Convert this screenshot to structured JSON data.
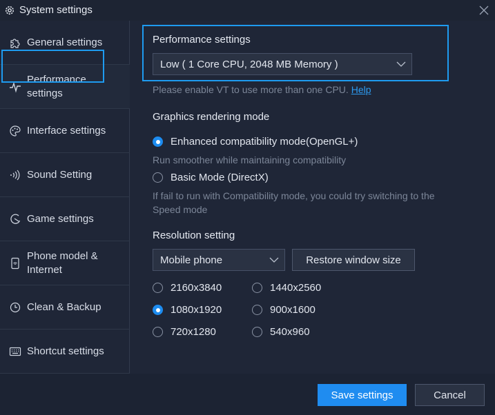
{
  "window": {
    "title": "System settings"
  },
  "sidebar": {
    "items": [
      {
        "label": "General settings",
        "icon": "puzzle-icon"
      },
      {
        "label": "Performance\nsettings",
        "icon": "pulse-icon"
      },
      {
        "label": "Interface settings",
        "icon": "palette-icon"
      },
      {
        "label": "Sound Setting",
        "icon": "sound-wave-icon"
      },
      {
        "label": "Game settings",
        "icon": "gamepad-icon"
      },
      {
        "label": "Phone model &\nInternet",
        "icon": "phone-icon"
      },
      {
        "label": "Clean & Backup",
        "icon": "clock-icon"
      },
      {
        "label": "Shortcut settings",
        "icon": "keyboard-icon"
      }
    ],
    "active_index": 1
  },
  "performance": {
    "heading": "Performance settings",
    "selected": "Low ( 1 Core CPU, 2048 MB Memory )",
    "vt_hint": "Please enable VT to use more than one CPU.",
    "help_link": "Help"
  },
  "graphics": {
    "heading": "Graphics rendering mode",
    "options": [
      {
        "label": "Enhanced compatibility mode(OpenGL+)",
        "checked": true,
        "desc": "Run smoother while maintaining compatibility"
      },
      {
        "label": "Basic Mode (DirectX)",
        "checked": false,
        "desc": " If fail to run with Compatibility mode, you could try switching to the\nSpeed mode"
      }
    ]
  },
  "resolution": {
    "heading": "Resolution setting",
    "device_selected": "Mobile phone",
    "restore_button": "Restore window size",
    "options": [
      {
        "label": "2160x3840",
        "checked": false
      },
      {
        "label": "1440x2560",
        "checked": false
      },
      {
        "label": "1080x1920",
        "checked": true
      },
      {
        "label": "900x1600",
        "checked": false
      },
      {
        "label": "720x1280",
        "checked": false
      },
      {
        "label": "540x960",
        "checked": false
      }
    ]
  },
  "footer": {
    "save_label": "Save settings",
    "cancel_label": "Cancel"
  },
  "colors": {
    "accent": "#1e9bf0",
    "background": "#1f2637",
    "primary_button": "#1f8cf0"
  }
}
